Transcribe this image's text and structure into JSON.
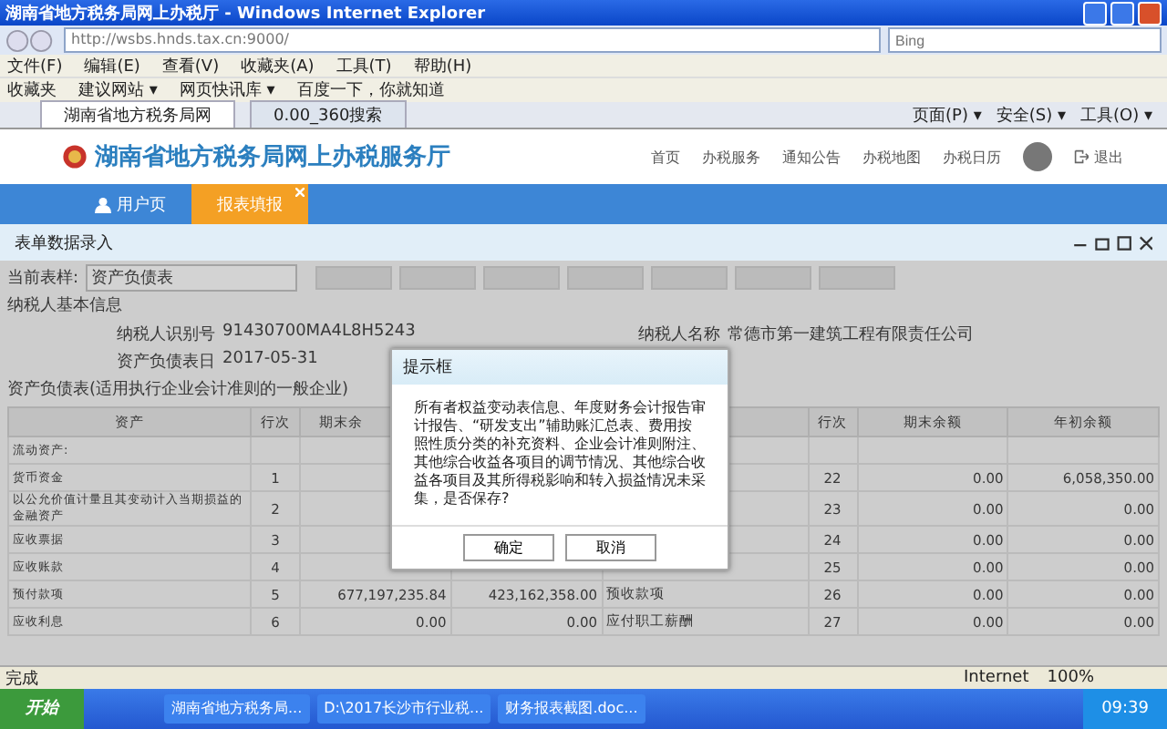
{
  "window": {
    "title": "湖南省地方税务局网上办税厅 - Windows Internet Explorer"
  },
  "ie": {
    "address": "http://wsbs.hnds.tax.cn:9000/",
    "search_placeholder": "Bing",
    "menu": [
      "文件(F)",
      "编辑(E)",
      "查看(V)",
      "收藏夹(A)",
      "工具(T)",
      "帮助(H)"
    ],
    "favorites": [
      "收藏夹",
      "建议网站 ▾",
      "网页快讯库 ▾",
      "百度一下，你就知道"
    ],
    "tabs": [
      {
        "label": "湖南省地方税务局网",
        "selected": true
      },
      {
        "label": "0.00_360搜索",
        "selected": false
      }
    ],
    "command_bar": [
      "页面(P) ▾",
      "安全(S) ▾",
      "工具(O) ▾"
    ]
  },
  "site": {
    "title": "湖南省地方税务局网上办税服务厅",
    "nav": [
      "首页",
      "办税服务",
      "通知公告",
      "办税地图",
      "办税日历"
    ],
    "logout": "退出",
    "tabs": [
      {
        "label": "用户页",
        "selected": false
      },
      {
        "label": "报表填报",
        "selected": true
      }
    ]
  },
  "panel": {
    "title": "表单数据录入",
    "toolbar": {
      "label": "当前表样:",
      "value": "资产负债表",
      "buttons": [
        {
          "disabled": true
        },
        {
          "disabled": true
        },
        {
          "disabled": true
        },
        {
          "disabled": true
        },
        {
          "disabled": true
        },
        {
          "disabled": true
        },
        {
          "disabled": true
        }
      ]
    },
    "section": "纳税人基本信息",
    "info": [
      {
        "label": "纳税人识别号",
        "value": "91430700MA4L8H5243"
      },
      {
        "label": "纳税人名称",
        "value": "常德市第一建筑工程有限责任公司"
      },
      {
        "label": "资产负债表日",
        "value": "2017-05-31"
      }
    ],
    "balance_title": "资产负债表(适用执行企业会计准则的一般企业)",
    "columns_left": [
      "资产",
      "行次",
      "期末余"
    ],
    "columns_right": [
      "行次",
      "期末余额",
      "年初余额"
    ],
    "rows": [
      {
        "a": "流动资产:"
      },
      {
        "a": "货币资金",
        "n": "1",
        "l_n": "22",
        "l_end": "0.00",
        "l_begin": "6,058,350.00"
      },
      {
        "a": "以公允价值计量且其变动计入当期损益的金融资产",
        "n": "2",
        "l_n": "23",
        "l_end": "0.00",
        "l_begin": "0.00"
      },
      {
        "a": "应收票据",
        "n": "3",
        "l_n": "24",
        "l_end": "0.00",
        "l_begin": "0.00"
      },
      {
        "a": "应收账款",
        "n": "4",
        "l_n": "25",
        "l_end": "0.00",
        "l_begin": "0.00"
      },
      {
        "a": "预付款项",
        "n": "5",
        "end": "677,197,235.84",
        "begin": "423,162,358.00",
        "l": "预收款项",
        "l_n": "26",
        "l_end": "0.00",
        "l_begin": "0.00"
      },
      {
        "a": "应收利息",
        "n": "6",
        "end": "0.00",
        "begin": "0.00",
        "l": "应付职工薪酬",
        "l_n": "27",
        "l_end": "0.00",
        "l_begin": "0.00"
      }
    ]
  },
  "dialog": {
    "title": "提示框",
    "message": "所有者权益变动表信息、年度财务会计报告审计报告、“研发支出”辅助账汇总表、费用按照性质分类的补充资料、企业会计准则附注、其他综合收益各项目的调节情况、其他综合收益各项目及其所得税影响和转入损益情况未采集，是否保存?",
    "buttons": [
      "确定",
      "取消"
    ]
  },
  "status_bar": {
    "text": "完成",
    "zone": "Internet",
    "zoom": "100%"
  },
  "taskbar": {
    "start": "开始",
    "items": [
      "湖南省地方税务局...",
      "D:\\2017长沙市行业税...",
      "财务报表截图.doc..."
    ],
    "clock": "09:39"
  }
}
